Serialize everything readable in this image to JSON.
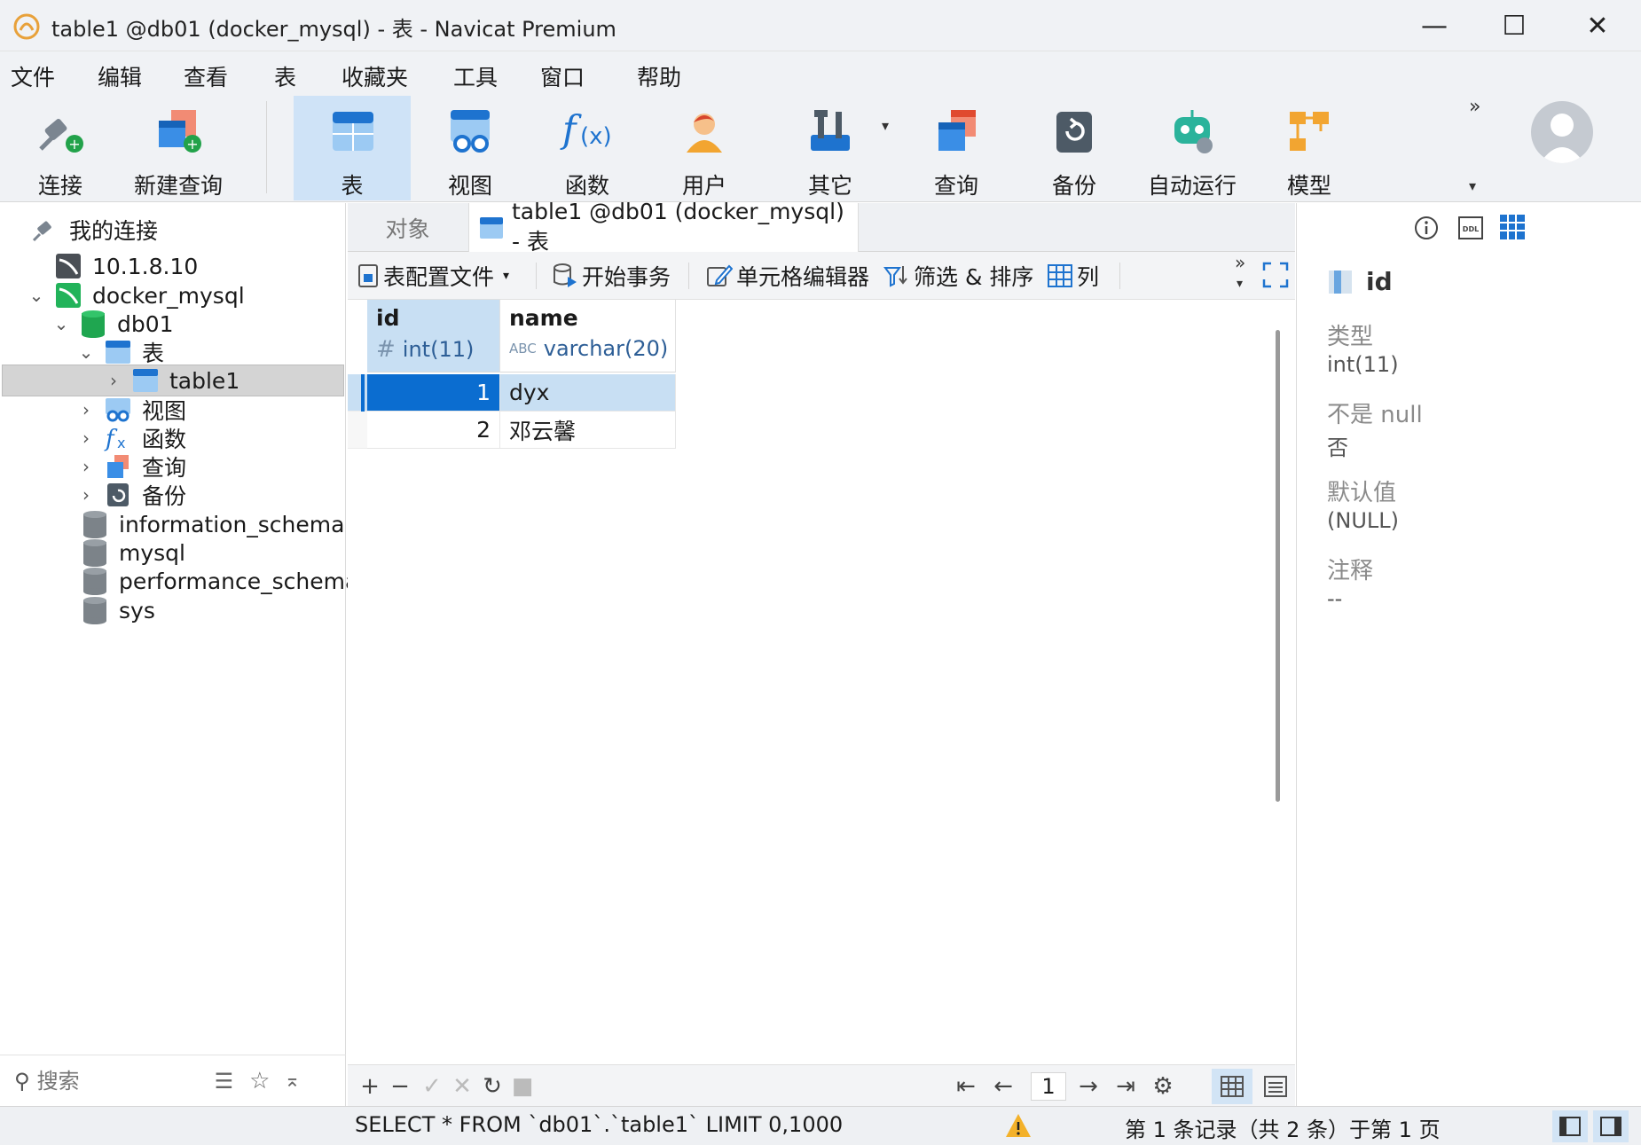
{
  "window": {
    "title": "table1 @db01 (docker_mysql) - 表 - Navicat Premium",
    "minimize": "—",
    "maximize": "☐",
    "close": "✕"
  },
  "menu": [
    "文件",
    "编辑",
    "查看",
    "表",
    "收藏夹",
    "工具",
    "窗口",
    "帮助"
  ],
  "toolbar": {
    "connect": "连接",
    "new_query": "新建查询",
    "table": "表",
    "view": "视图",
    "function": "函数",
    "user": "用户",
    "other": "其它",
    "query": "查询",
    "backup": "备份",
    "automation": "自动运行",
    "model": "模型",
    "more": "»"
  },
  "nav": {
    "root": "我的连接",
    "conn1": "10.1.8.10",
    "conn2": "docker_mysql",
    "db": "db01",
    "tables": "表",
    "table1": "table1",
    "views": "视图",
    "functions": "函数",
    "queries": "查询",
    "backups": "备份",
    "other_dbs": [
      "information_schema",
      "mysql",
      "performance_schema",
      "sys"
    ],
    "search_placeholder": "搜索"
  },
  "tabs": {
    "objects": "对象",
    "active": "table1 @db01 (docker_mysql) - 表"
  },
  "subtoolbar": {
    "profile": "表配置文件",
    "begin_tx": "开始事务",
    "cell_editor": "单元格编辑器",
    "filter_sort": "筛选 & 排序",
    "columns": "列"
  },
  "grid": {
    "columns": [
      {
        "name": "id",
        "type": "int(11)",
        "type_icon": "#"
      },
      {
        "name": "name",
        "type": "varchar(20)",
        "type_icon": "ABC"
      }
    ],
    "rows": [
      {
        "id": "1",
        "name": "dyx"
      },
      {
        "id": "2",
        "name": "邓云馨"
      }
    ]
  },
  "pager": {
    "page": "1"
  },
  "info": {
    "field": "id",
    "type_label": "类型",
    "type_value": "int(11)",
    "notnull_label": "不是 null",
    "notnull_value": "否",
    "default_label": "默认值",
    "default_value": "(NULL)",
    "comment_label": "注释",
    "comment_value": "--"
  },
  "status": {
    "sql": "SELECT * FROM `db01`.`table1` LIMIT 0,1000",
    "records": "第 1 条记录（共 2 条）于第 1 页"
  },
  "colors": {
    "accent": "#0b6dd0",
    "selection": "#c8dff3",
    "chrome": "#f0f2f5"
  }
}
